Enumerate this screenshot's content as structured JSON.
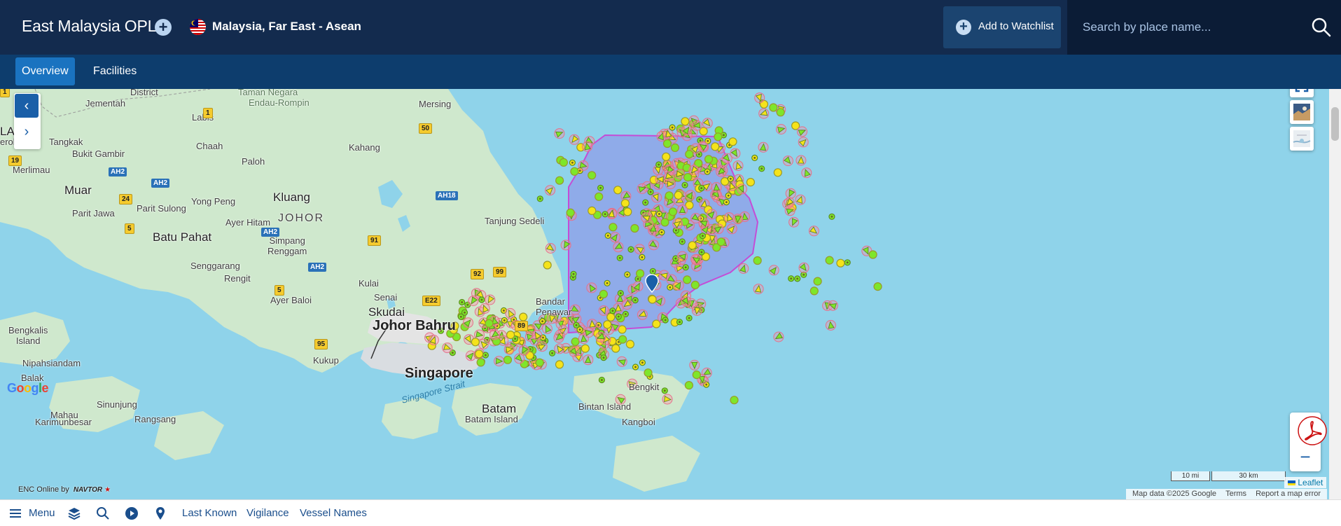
{
  "header": {
    "title": "East Malaysia OPL",
    "region": "Malaysia, Far East - Asean",
    "watchlist_label": "Add to Watchlist",
    "search_placeholder": "Search by place name..."
  },
  "tabs": [
    {
      "label": "Overview",
      "active": true
    },
    {
      "label": "Facilities",
      "active": false
    }
  ],
  "map": {
    "labels": {
      "district": "District",
      "taman_negara": "Taman Negara",
      "endau_rompin": "Endau-Rompin",
      "jementah": "Jementah",
      "mersing": "Mersing",
      "labis": "Labis",
      "laka": "LAKA",
      "eroh": "eroh",
      "tangkak": "Tangkak",
      "chaah": "Chaah",
      "kahang": "Kahang",
      "bukit_gambir": "Bukit Gambir",
      "merlimau": "Merlimau",
      "paloh": "Paloh",
      "muar": "Muar",
      "kluang": "Kluang",
      "yong_peng": "Yong Peng",
      "parit_sulong": "Parit Sulong",
      "parit_jawa": "Parit Jawa",
      "ayer_hitam": "Ayer Hitam",
      "johor": "JOHOR",
      "tanjung_sedeli": "Tanjung Sedeli",
      "batu_pahat": "Batu Pahat",
      "simpang_renggam": "Simpang\nRenggam",
      "senggarang": "Senggarang",
      "rengit": "Rengit",
      "kulai": "Kulai",
      "ayer_baloi": "Ayer Baloi",
      "senai": "Senai",
      "skudai": "Skudai",
      "bandar_penawar": "Bandar\nPenawar",
      "johor_bahru": "Johor Bahru",
      "bengkalis_island": "Bengkalis\nIsland",
      "kukup": "Kukup",
      "nipahsiandam": "Nipahsiandam",
      "singapore": "Singapore",
      "balak": "Balak",
      "singapore_strait": "Singapore Strait",
      "bengkit": "Bengkit",
      "sinunjung": "Sinunjung",
      "batam": "Batam",
      "bintan_island": "Bintan Island",
      "rangsang": "Rangsang",
      "karimunbesar": "Karimunbesar",
      "batam_island": "Batam Island",
      "kangboi": "Kangboi",
      "mahau": "Mahau"
    },
    "roads": [
      {
        "label": "1",
        "type": "y"
      },
      {
        "label": "1",
        "type": "y"
      },
      {
        "label": "50",
        "type": "y"
      },
      {
        "label": "19",
        "type": "y"
      },
      {
        "label": "AH2",
        "type": "b"
      },
      {
        "label": "AH2",
        "type": "b"
      },
      {
        "label": "AH18",
        "type": "b"
      },
      {
        "label": "24",
        "type": "y"
      },
      {
        "label": "AH2",
        "type": "b"
      },
      {
        "label": "5",
        "type": "y"
      },
      {
        "label": "91",
        "type": "y"
      },
      {
        "label": "AH2",
        "type": "b"
      },
      {
        "label": "92",
        "type": "y"
      },
      {
        "label": "99",
        "type": "y"
      },
      {
        "label": "5",
        "type": "y"
      },
      {
        "label": "E22",
        "type": "y"
      },
      {
        "label": "89",
        "type": "y"
      },
      {
        "label": "95",
        "type": "y"
      }
    ],
    "scale": {
      "mi": "10 mi",
      "km": "30 km"
    },
    "leaflet": "Leaflet",
    "attribution": {
      "data": "Map data ©2025 Google",
      "terms": "Terms",
      "report": "Report a map error"
    },
    "google_logo": "Google",
    "enc_text": "ENC Online by",
    "naviter": "NAVTOR"
  },
  "bottom": {
    "menu": "Menu",
    "last_known": "Last Known",
    "vigilance": "Vigilance",
    "vessel_names": "Vessel Names"
  },
  "colors": {
    "header_bg": "#132b4e",
    "tab_bg": "#0d3d6d",
    "tab_active": "#1a73c0",
    "sea": "#8fd3ea",
    "land": "#cfe8cd",
    "zone_fill": "#8f9ee8",
    "zone_stroke": "#c44dd6",
    "vessel_green": "#7ee62a",
    "vessel_yellow": "#f5e31a"
  }
}
